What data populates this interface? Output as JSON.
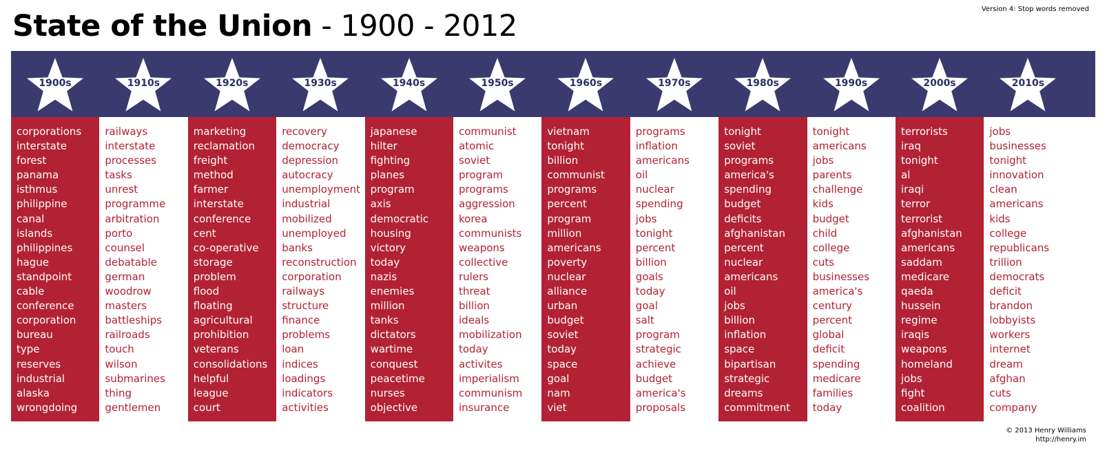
{
  "title": {
    "main": "State of the Union",
    "suffix": " - 1900 - 2012"
  },
  "version_note": "Version 4: Stop words removed",
  "colors": {
    "banner": "#3a3a6e",
    "red": "#b22234",
    "white": "#ffffff",
    "decade_text": "#2e2e66"
  },
  "decades": [
    {
      "label": "1900s",
      "words": [
        "corporations",
        "interstate",
        "forest",
        "panama",
        "isthmus",
        "philippine",
        "canal",
        "islands",
        "philippines",
        "hague",
        "standpoint",
        "cable",
        "conference",
        "corporation",
        "bureau",
        "type",
        "reserves",
        "industrial",
        "alaska",
        "wrongdoing"
      ]
    },
    {
      "label": "1910s",
      "words": [
        "railways",
        "interstate",
        "processes",
        "tasks",
        "unrest",
        "programme",
        "arbitration",
        "porto",
        "counsel",
        "debatable",
        "german",
        "woodrow",
        "masters",
        "battleships",
        "railroads",
        "touch",
        "wilson",
        "submarines",
        "thing",
        "gentlemen"
      ]
    },
    {
      "label": "1920s",
      "words": [
        "marketing",
        "reclamation",
        "freight",
        "method",
        "farmer",
        "interstate",
        "conference",
        "cent",
        "co-operative",
        "storage",
        "problem",
        "flood",
        "floating",
        "agricultural",
        "prohibition",
        "veterans",
        "consolidations",
        "helpful",
        "league",
        "court"
      ]
    },
    {
      "label": "1930s",
      "words": [
        "recovery",
        "democracy",
        "depression",
        "autocracy",
        "unemployment",
        "industrial",
        "mobilized",
        "unemployed",
        "banks",
        "reconstruction",
        "corporation",
        "railways",
        "structure",
        "finance",
        "problems",
        "loan",
        "indices",
        "loadings",
        "indicators",
        "activities"
      ]
    },
    {
      "label": "1940s",
      "words": [
        "japanese",
        "hilter",
        "fighting",
        "planes",
        "program",
        "axis",
        "democratic",
        "housing",
        "victory",
        "today",
        "nazis",
        "enemies",
        "million",
        "tanks",
        "dictators",
        "wartime",
        "conquest",
        "peacetime",
        "nurses",
        "objective"
      ]
    },
    {
      "label": "1950s",
      "words": [
        "communist",
        "atomic",
        "soviet",
        "program",
        "programs",
        "aggression",
        "korea",
        "communists",
        "weapons",
        "collective",
        "rulers",
        "threat",
        "billion",
        "ideals",
        "mobilization",
        "today",
        "activites",
        "imperialism",
        "communism",
        "insurance"
      ]
    },
    {
      "label": "1960s",
      "words": [
        "vietnam",
        "tonight",
        "billion",
        "communist",
        "programs",
        "percent",
        "program",
        "million",
        "americans",
        "poverty",
        "nuclear",
        "alliance",
        "urban",
        "budget",
        "soviet",
        "today",
        "space",
        "goal",
        "nam",
        "viet"
      ]
    },
    {
      "label": "1970s",
      "words": [
        "programs",
        "inflation",
        "americans",
        "oil",
        "nuclear",
        "spending",
        "jobs",
        "tonight",
        "percent",
        "billion",
        "goals",
        "today",
        "goal",
        "salt",
        "program",
        "strategic",
        "achieve",
        "budget",
        "america's",
        "proposals"
      ]
    },
    {
      "label": "1980s",
      "words": [
        "tonight",
        "soviet",
        "programs",
        "america's",
        "spending",
        "budget",
        "deficits",
        "afghanistan",
        "percent",
        "nuclear",
        "americans",
        "oil",
        "jobs",
        "billion",
        "inflation",
        "space",
        "bipartisan",
        "strategic",
        "dreams",
        "commitment"
      ]
    },
    {
      "label": "1990s",
      "words": [
        "tonight",
        "americans",
        "jobs",
        "parents",
        "challenge",
        "kids",
        "budget",
        "child",
        "college",
        "cuts",
        "businesses",
        "america's",
        "century",
        "percent",
        "global",
        "deficit",
        "spending",
        "medicare",
        "families",
        "today"
      ]
    },
    {
      "label": "2000s",
      "words": [
        "terrorists",
        "iraq",
        "tonight",
        "al",
        "iraqi",
        "terror",
        "terrorist",
        "afghanistan",
        "americans",
        "saddam",
        "medicare",
        "qaeda",
        "hussein",
        "regime",
        "iraqis",
        "weapons",
        "homeland",
        "jobs",
        "fight",
        "coalition"
      ]
    },
    {
      "label": "2010s",
      "words": [
        "jobs",
        "businesses",
        "tonight",
        "innovation",
        "clean",
        "americans",
        "kids",
        "college",
        "republicans",
        "trillion",
        "democrats",
        "deficit",
        "brandon",
        "lobbyists",
        "workers",
        "internet",
        "dream",
        "afghan",
        "cuts",
        "company"
      ]
    }
  ],
  "credit": {
    "line1": "© 2013 Henry Williams",
    "line2": "http://henry.im"
  }
}
